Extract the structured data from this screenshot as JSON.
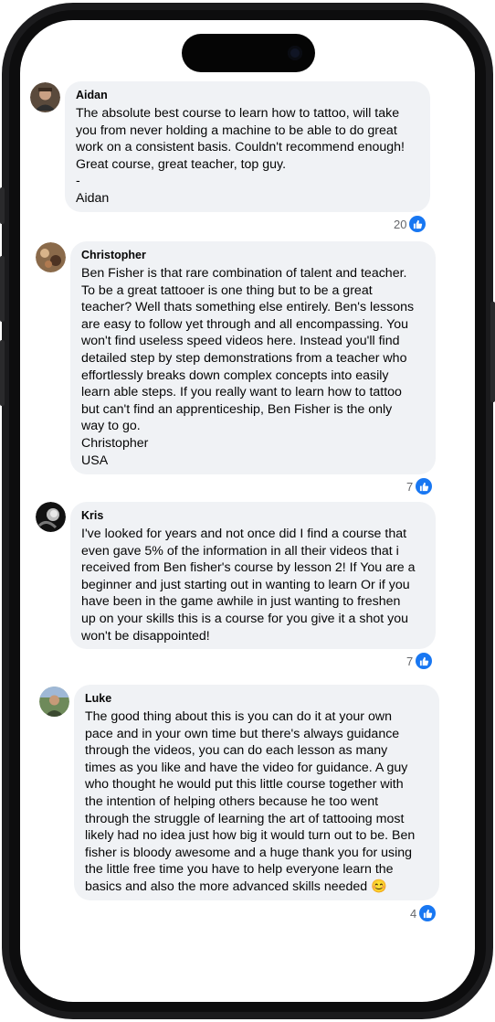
{
  "comments": [
    {
      "name": "Aidan",
      "text": "The absolute best course to learn how to tattoo, will take\nyou from never holding a machine to be able to do great\nwork on a consistent basis. Couldn't recommend enough!\nGreat course, great teacher, top guy.\n-\nAidan",
      "likes": "20",
      "avatar_icon": "profile-photo"
    },
    {
      "name": "Christopher",
      "text": "Ben Fisher is that rare combination of talent and teacher.\nTo be a great tattooer is one thing but to be a great\nteacher? Well thats something else entirely. Ben's lessons\nare easy to follow yet through and all encompassing. You\nwon't find useless speed videos here. Instead you'll find\ndetailed step by step demonstrations from a teacher who\neffortlessly breaks down complex concepts into easily\nlearn able steps. If you really want to learn how to tattoo\nbut can't find an apprenticeship, Ben Fisher is the only\nway to go.\nChristopher\nUSA",
      "likes": "7",
      "avatar_icon": "profile-photo"
    },
    {
      "name": "Kris",
      "text": "I've looked for years and not once did I find a course that\neven gave 5% of the information in all their videos that i\nreceived from Ben fisher's course by lesson 2! If You are a\nbeginner and just starting out in wanting to learn Or if you\nhave been in the game awhile in just wanting to freshen\nup on your skills this is a course for you give it a shot you\nwon't be disappointed!",
      "likes": "7",
      "avatar_icon": "profile-photo"
    },
    {
      "name": "Luke",
      "text": "The good thing about this is you can do it at your own\npace and in your own time but there's always guidance\nthrough the videos, you can do each lesson as many\ntimes as you like and have the video for guidance. A guy\nwho thought he would put this little course together with\nthe intention of helping others because he too went\nthrough the struggle of learning the art of tattooing most\nlikely had no idea just how big it would turn out to be. Ben\nfisher is bloody awesome and a huge thank you for using\nthe little free time you have to help everyone learn the\nbasics and also the more advanced skills needed 😊",
      "likes": "4",
      "avatar_icon": "profile-photo"
    }
  ],
  "reaction_icon": "thumbs-up-icon",
  "colors": {
    "bubble": "#f0f2f5",
    "like_blue": "#1877f2",
    "count_gray": "#65676b",
    "frame": "#1b1b1d"
  }
}
